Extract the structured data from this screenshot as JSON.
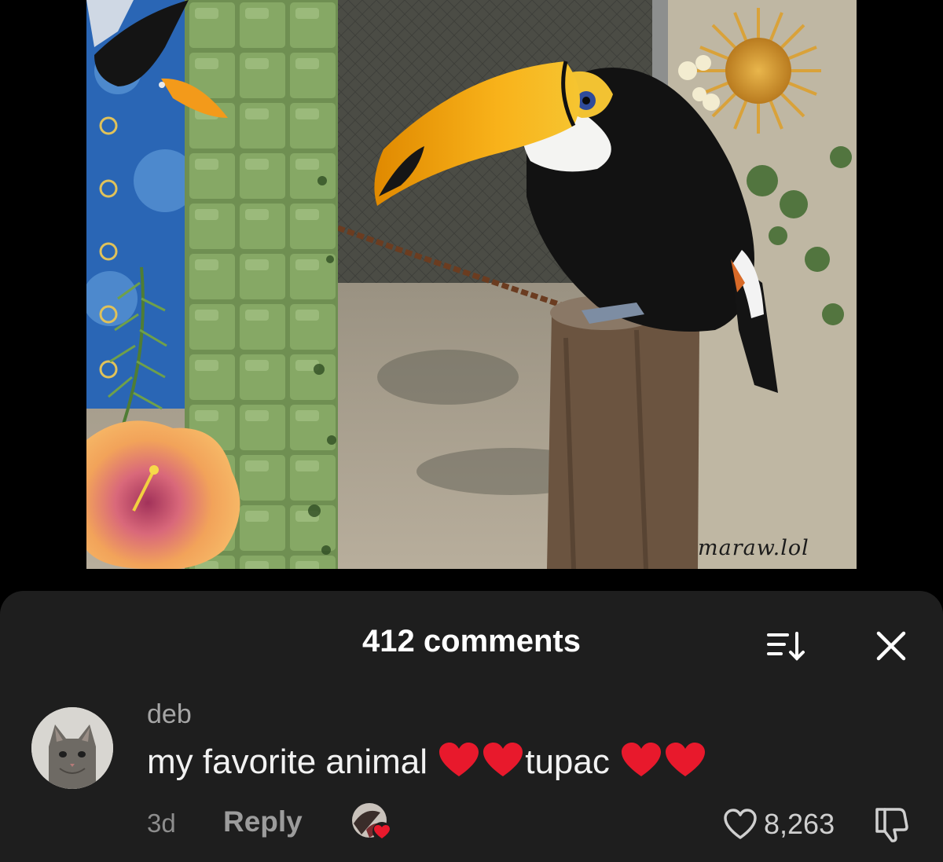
{
  "media": {
    "watermark": "maraw.lol"
  },
  "comments_sheet": {
    "title": "412 comments",
    "sort_icon": "sort-icon",
    "close_icon": "close-icon"
  },
  "comment": {
    "username": "deb",
    "text_part1": "my favorite animal ",
    "text_part2": "tupac ",
    "emoji": "red-heart-emoji",
    "timestamp": "3d",
    "reply_label": "Reply",
    "likes": "8,263",
    "like_icon": "heart-outline-icon",
    "dislike_icon": "thumbs-down-icon",
    "creator_liked_icon": "creator-liked-icon"
  },
  "colors": {
    "sheet_bg": "#1e1e1e",
    "heart_red": "#e8192c",
    "toucan_beak": "#f6a400"
  }
}
